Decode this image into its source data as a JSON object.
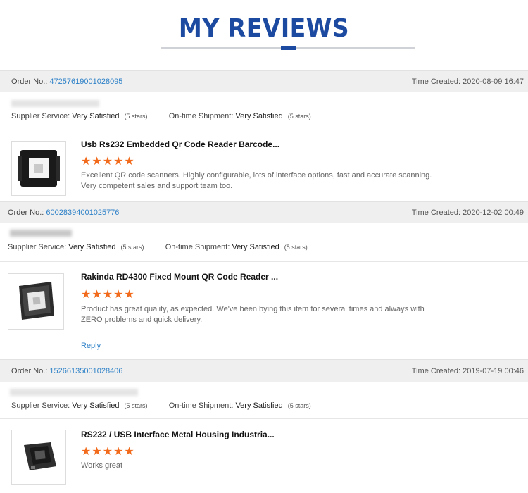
{
  "header": {
    "title": "MY REVIEWS"
  },
  "labels": {
    "order_no": "Order No.:",
    "time_created": "Time Created:",
    "supplier_service": "Supplier Service:",
    "ontime_shipment": "On-time Shipment:",
    "reply": "Reply"
  },
  "colors": {
    "accent": "#1c4aa0",
    "link": "#2f82c8",
    "star": "#f26b1d"
  },
  "reviews": [
    {
      "order_no": "47257619001028095",
      "time_created": "2020-08-09 16:47",
      "supplier_service": "Very Satisfied",
      "supplier_service_stars": "(5 stars)",
      "ontime_shipment": "Very Satisfied",
      "ontime_shipment_stars": "(5 stars)",
      "product_title": "Usb Rs232 Embedded Qr Code Reader Barcode...",
      "rating": 5,
      "stars_text": "★★★★★",
      "text": "Excellent QR code scanners. Highly configurable, lots of interface options, fast and accurate scanning. Very competent sales and support team too.",
      "thumb_icon": "embedded-scanner-icon"
    },
    {
      "order_no": "60028394001025776",
      "time_created": "2020-12-02 00:49",
      "supplier_service": "Very Satisfied",
      "supplier_service_stars": "(5 stars)",
      "ontime_shipment": "Very Satisfied",
      "ontime_shipment_stars": "(5 stars)",
      "product_title": "Rakinda RD4300 Fixed Mount QR Code Reader ...",
      "rating": 5,
      "stars_text": "★★★★★",
      "text": "Product has great quality, as expected. We've been bying this item for several times and always with ZERO problems and quick delivery.",
      "reply": "Reply",
      "thumb_icon": "fixed-mount-scanner-icon"
    },
    {
      "order_no": "15266135001028406",
      "time_created": "2019-07-19 00:46",
      "supplier_service": "Very Satisfied",
      "supplier_service_stars": "(5 stars)",
      "ontime_shipment": "Very Satisfied",
      "ontime_shipment_stars": "(5 stars)",
      "product_title": "RS232 / USB Interface Metal Housing Industria...",
      "rating": 5,
      "stars_text": "★★★★★",
      "text": "Works great",
      "thumb_icon": "metal-housing-scanner-icon"
    }
  ]
}
